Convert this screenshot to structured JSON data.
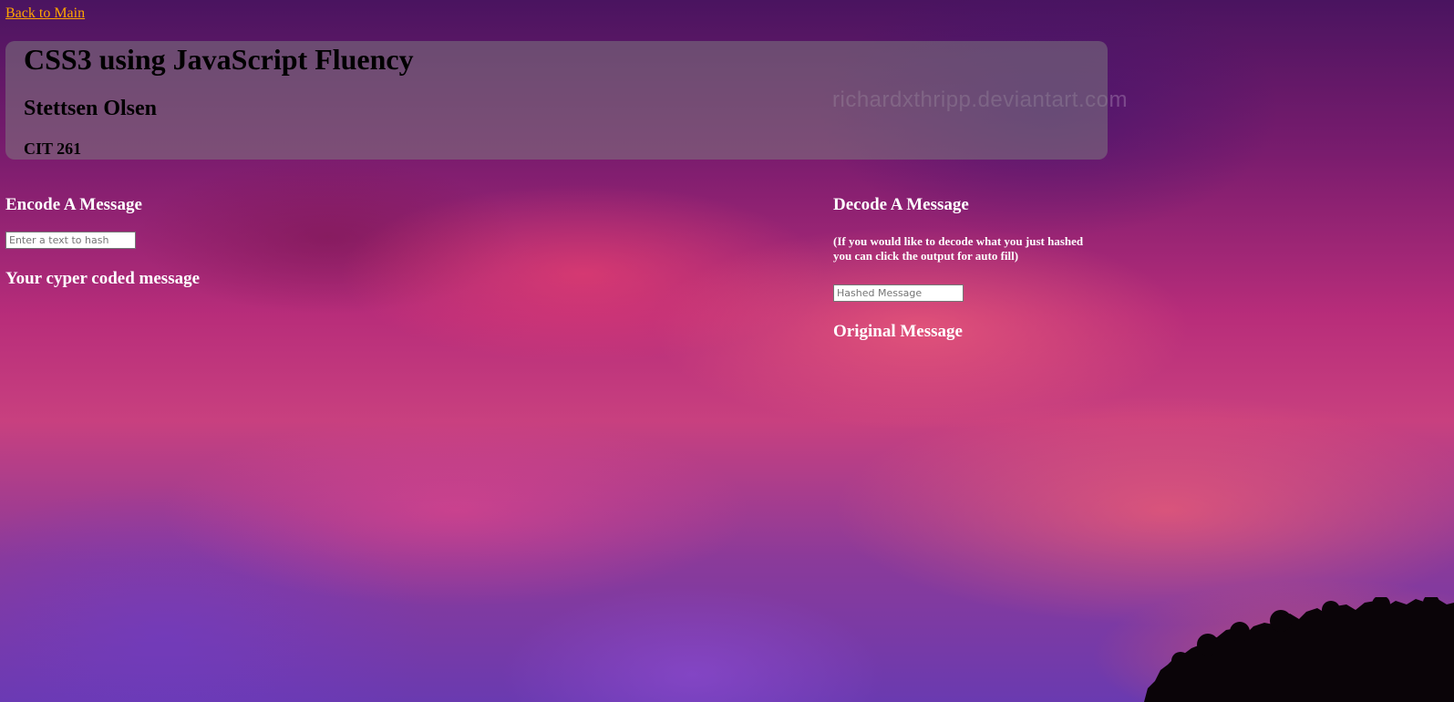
{
  "nav": {
    "back_link": "Back to Main"
  },
  "header": {
    "title": "CSS3 using JavaScript Fluency",
    "author": "Stettsen Olsen",
    "course": "CIT 261"
  },
  "watermark": "richardxthripp.deviantart.com",
  "encode": {
    "heading": "Encode A Message",
    "input_value": "",
    "input_placeholder": "Enter a text to hash",
    "output_heading": "Your cyper coded message"
  },
  "decode": {
    "heading": "Decode A Message",
    "note": "(If you would like to decode what you just hashed you can click the output for auto fill)",
    "input_value": "",
    "input_placeholder": "Hashed Message",
    "output_heading": "Original Message"
  },
  "colors": {
    "link": "#ffa500",
    "panel_bg": "rgba(128,128,128,0.5)",
    "heading_text": "#ffffff"
  }
}
